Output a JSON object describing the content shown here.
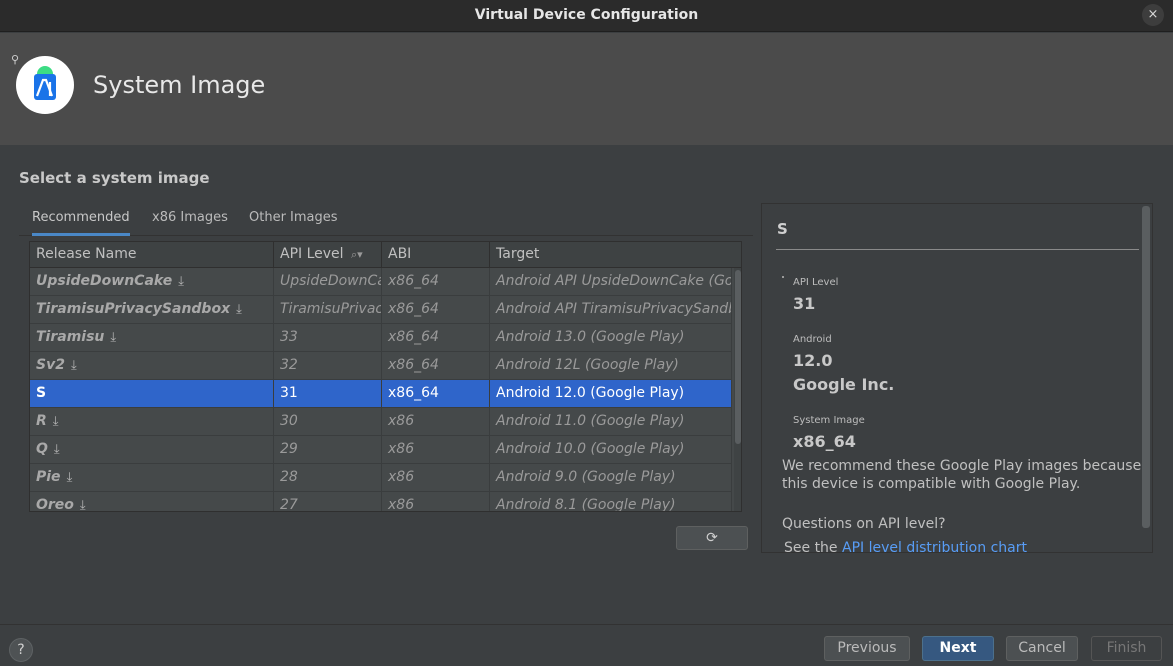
{
  "window": {
    "title": "Virtual Device Configuration",
    "close_glyph": "×"
  },
  "header": {
    "title": "System Image",
    "logo_text": "AI",
    "mag_glyph": "⚲"
  },
  "section_title": "Select a system image",
  "tabs": [
    {
      "label": "Recommended",
      "active": true
    },
    {
      "label": "x86 Images",
      "active": false
    },
    {
      "label": "Other Images",
      "active": false
    }
  ],
  "table": {
    "columns": [
      "Release Name",
      "API Level",
      "ABI",
      "Target"
    ],
    "sort_icon_glyph": "⌕▾",
    "download_glyph": "⤓",
    "rows": [
      {
        "release": "UpsideDownCake",
        "api": "UpsideDownCake",
        "abi": "x86_64",
        "target": "Android API UpsideDownCake (Google Play)",
        "download": true,
        "selected": false
      },
      {
        "release": "TiramisuPrivacySandbox",
        "api": "TiramisuPrivacySandbox",
        "abi": "x86_64",
        "target": "Android API TiramisuPrivacySandbox (Google Play)",
        "download": true,
        "selected": false
      },
      {
        "release": "Tiramisu",
        "api": "33",
        "abi": "x86_64",
        "target": "Android 13.0 (Google Play)",
        "download": true,
        "selected": false
      },
      {
        "release": "Sv2",
        "api": "32",
        "abi": "x86_64",
        "target": "Android 12L (Google Play)",
        "download": true,
        "selected": false
      },
      {
        "release": "S",
        "api": "31",
        "abi": "x86_64",
        "target": "Android 12.0 (Google Play)",
        "download": false,
        "selected": true
      },
      {
        "release": "R",
        "api": "30",
        "abi": "x86",
        "target": "Android 11.0 (Google Play)",
        "download": true,
        "selected": false
      },
      {
        "release": "Q",
        "api": "29",
        "abi": "x86",
        "target": "Android 10.0 (Google Play)",
        "download": true,
        "selected": false
      },
      {
        "release": "Pie",
        "api": "28",
        "abi": "x86",
        "target": "Android 9.0 (Google Play)",
        "download": true,
        "selected": false
      },
      {
        "release": "Oreo",
        "api": "27",
        "abi": "x86",
        "target": "Android 8.1 (Google Play)",
        "download": true,
        "selected": false
      }
    ]
  },
  "refresh_glyph": "⟳",
  "detail": {
    "title": "S",
    "api_level_label": "API Level",
    "api_level_value": "31",
    "android_label": "Android",
    "android_version": "12.0",
    "vendor": "Google Inc.",
    "system_image_label": "System Image",
    "system_image_value": "x86_64",
    "recommend_text": "We recommend these Google Play images because this device is compatible with Google Play.",
    "questions_text": "Questions on API level?",
    "see_prefix": "See the ",
    "link_text": "API level distribution chart"
  },
  "footer": {
    "help_glyph": "?",
    "previous": "Previous",
    "next": "Next",
    "cancel": "Cancel",
    "finish": "Finish"
  },
  "colors": {
    "accent": "#2f65ca",
    "primary_button": "#365880",
    "link": "#589df6"
  }
}
